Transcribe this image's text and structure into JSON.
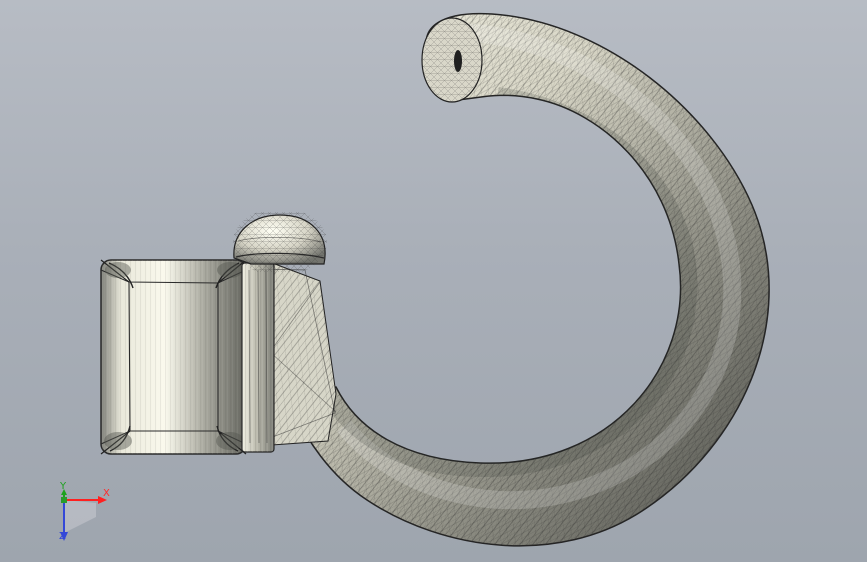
{
  "viewport": {
    "background_top": "#b7bcc4",
    "background_bottom": "#9ea5ae"
  },
  "model": {
    "name": "ring-with-square-setting",
    "render_mode": "shaded-with-mesh-edges",
    "body_color": "#d8d7c8",
    "edge_color": "#202020"
  },
  "triad": {
    "x_label": "X",
    "y_label": "Y",
    "z_label": "Z",
    "x_color": "#ff2a2a",
    "y_color": "#1ea21e",
    "z_color": "#3448d8"
  }
}
